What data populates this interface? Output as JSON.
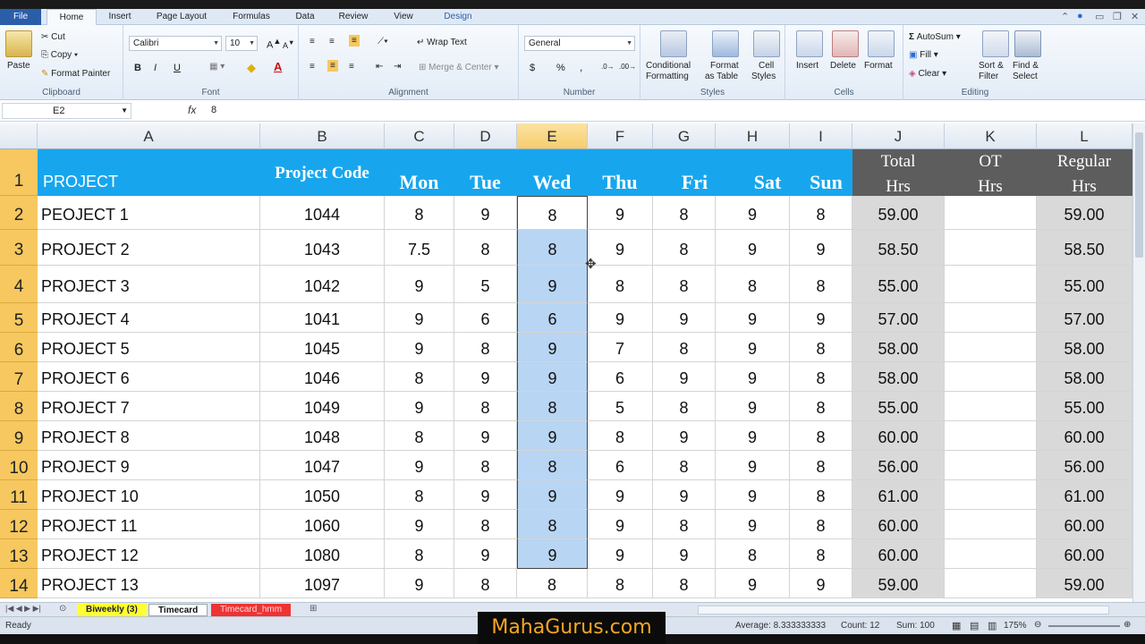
{
  "ribbon_tabs": [
    "File",
    "Home",
    "Insert",
    "Page Layout",
    "Formulas",
    "Data",
    "Review",
    "View",
    "Design"
  ],
  "clipboard": {
    "paste": "Paste",
    "cut": "Cut",
    "copy": "Copy",
    "format_painter": "Format Painter",
    "label": "Clipboard"
  },
  "font": {
    "name": "Calibri",
    "size": "10",
    "label": "Font",
    "bold": "B",
    "italic": "I",
    "underline": "U"
  },
  "alignment": {
    "wrap_text": "Wrap Text",
    "merge_center": "Merge & Center",
    "label": "Alignment"
  },
  "number": {
    "format": "General",
    "currency": "$",
    "percent": "%",
    "comma": ",",
    "label": "Number"
  },
  "styles": {
    "conditional": "Conditional",
    "conditional2": "Formatting",
    "format_table": "Format",
    "format_table2": "as Table",
    "cell_styles": "Cell",
    "cell_styles2": "Styles",
    "label": "Styles"
  },
  "cells": {
    "insert": "Insert",
    "delete": "Delete",
    "format": "Format",
    "label": "Cells"
  },
  "editing": {
    "autosum": "AutoSum",
    "fill": "Fill",
    "clear": "Clear",
    "sort": "Sort &",
    "sort2": "Filter",
    "find": "Find &",
    "find2": "Select",
    "label": "Editing"
  },
  "formula_bar": {
    "name_box": "E2",
    "fx": "fx",
    "value": "8"
  },
  "columns": [
    "A",
    "B",
    "C",
    "D",
    "E",
    "F",
    "G",
    "H",
    "I",
    "J",
    "K",
    "L"
  ],
  "header_row": {
    "project": "PROJECT",
    "code": "Project Code",
    "mon": "Mon",
    "tue": "Tue",
    "wed": "Wed",
    "thu": "Thu",
    "fri": "Fri",
    "sat": "Sat",
    "sun": "Sun",
    "total1": "Total",
    "total2": "Hrs",
    "ot1": "OT",
    "ot2": "Hrs",
    "reg1": "Regular",
    "reg2": "Hrs"
  },
  "rows": [
    {
      "n": "2",
      "project": "PEOJECT 1",
      "code": "1044",
      "d": [
        "8",
        "9",
        "8",
        "9",
        "8",
        "9",
        "8"
      ],
      "total": "59.00",
      "ot": "",
      "reg": "59.00"
    },
    {
      "n": "3",
      "project": "PROJECT 2",
      "code": "1043",
      "d": [
        "7.5",
        "8",
        "8",
        "9",
        "8",
        "9",
        "9"
      ],
      "total": "58.50",
      "ot": "",
      "reg": "58.50"
    },
    {
      "n": "4",
      "project": "PROJECT 3",
      "code": "1042",
      "d": [
        "9",
        "5",
        "9",
        "8",
        "8",
        "8",
        "8"
      ],
      "total": "55.00",
      "ot": "",
      "reg": "55.00"
    },
    {
      "n": "5",
      "project": "PROJECT 4",
      "code": "1041",
      "d": [
        "9",
        "6",
        "6",
        "9",
        "9",
        "9",
        "9"
      ],
      "total": "57.00",
      "ot": "",
      "reg": "57.00"
    },
    {
      "n": "6",
      "project": "PROJECT 5",
      "code": "1045",
      "d": [
        "9",
        "8",
        "9",
        "7",
        "8",
        "9",
        "8"
      ],
      "total": "58.00",
      "ot": "",
      "reg": "58.00"
    },
    {
      "n": "7",
      "project": "PROJECT 6",
      "code": "1046",
      "d": [
        "8",
        "9",
        "9",
        "6",
        "9",
        "9",
        "8"
      ],
      "total": "58.00",
      "ot": "",
      "reg": "58.00"
    },
    {
      "n": "8",
      "project": "PROJECT 7",
      "code": "1049",
      "d": [
        "9",
        "8",
        "8",
        "5",
        "8",
        "9",
        "8"
      ],
      "total": "55.00",
      "ot": "",
      "reg": "55.00"
    },
    {
      "n": "9",
      "project": "PROJECT 8",
      "code": "1048",
      "d": [
        "8",
        "9",
        "9",
        "8",
        "9",
        "9",
        "8"
      ],
      "total": "60.00",
      "ot": "",
      "reg": "60.00"
    },
    {
      "n": "10",
      "project": "PROJECT 9",
      "code": "1047",
      "d": [
        "9",
        "8",
        "8",
        "6",
        "8",
        "9",
        "8"
      ],
      "total": "56.00",
      "ot": "",
      "reg": "56.00"
    },
    {
      "n": "11",
      "project": "PROJECT 10",
      "code": "1050",
      "d": [
        "8",
        "9",
        "9",
        "9",
        "9",
        "9",
        "8"
      ],
      "total": "61.00",
      "ot": "",
      "reg": "61.00"
    },
    {
      "n": "12",
      "project": "PROJECT 11",
      "code": "1060",
      "d": [
        "9",
        "8",
        "8",
        "9",
        "8",
        "9",
        "8"
      ],
      "total": "60.00",
      "ot": "",
      "reg": "60.00"
    },
    {
      "n": "13",
      "project": "PROJECT 12",
      "code": "1080",
      "d": [
        "8",
        "9",
        "9",
        "9",
        "9",
        "8",
        "8"
      ],
      "total": "60.00",
      "ot": "",
      "reg": "60.00"
    },
    {
      "n": "14",
      "project": "PROJECT 13",
      "code": "1097",
      "d": [
        "9",
        "8",
        "8",
        "8",
        "8",
        "9",
        "9"
      ],
      "total": "59.00",
      "ot": "",
      "reg": "59.00"
    }
  ],
  "sheet_tabs": [
    "Biweekly (3)",
    "Timecard",
    "Timecard_hmm"
  ],
  "status": {
    "ready": "Ready",
    "average": "Average: 8.333333333",
    "count": "Count: 12",
    "sum": "Sum: 100",
    "zoom": "175%"
  },
  "watermark": "MahaGurus.com",
  "colors": {
    "header_blue": "#17a6ee",
    "header_dark": "#5d5d5d",
    "row_header": "#f6c85f",
    "selection": "#b8d5f3"
  }
}
